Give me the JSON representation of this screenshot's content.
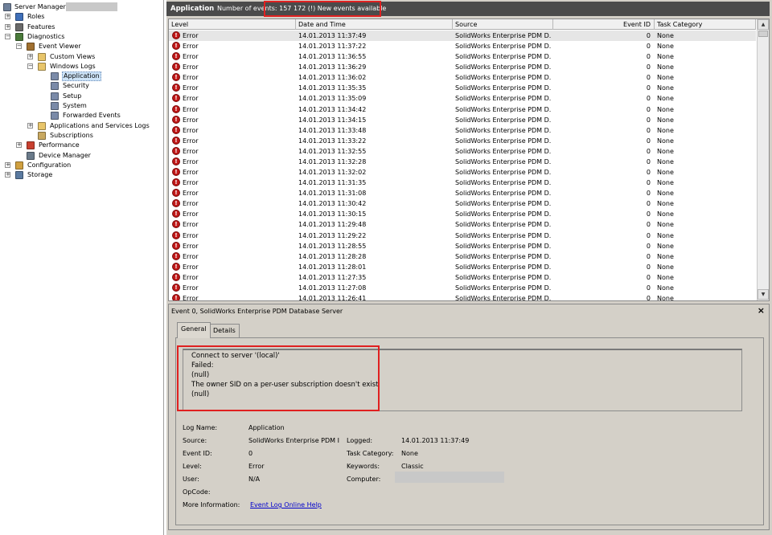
{
  "tree": {
    "items": [
      {
        "label": "Server Manager",
        "expander": "",
        "icon": "server-icon",
        "color": "#6d7f99",
        "level": 0
      },
      {
        "label": "Roles",
        "expander": "+",
        "icon": "roles-icon",
        "color": "#3f6fb8",
        "level": 1
      },
      {
        "label": "Features",
        "expander": "+",
        "icon": "features-icon",
        "color": "#6a6a6a",
        "level": 1
      },
      {
        "label": "Diagnostics",
        "expander": "−",
        "icon": "diagnostics-icon",
        "color": "#4a7a3a",
        "level": 1
      },
      {
        "label": "Event Viewer",
        "expander": "−",
        "icon": "event-viewer-icon",
        "color": "#a07030",
        "level": 2
      },
      {
        "label": "Custom Views",
        "expander": "+",
        "icon": "folder-icon",
        "color": "#e8c56a",
        "level": 3
      },
      {
        "label": "Windows Logs",
        "expander": "−",
        "icon": "folder-icon",
        "color": "#e8c56a",
        "level": 3
      },
      {
        "label": "Application",
        "expander": "",
        "icon": "log-icon",
        "color": "#7a8aa8",
        "level": 4,
        "selected": true
      },
      {
        "label": "Security",
        "expander": "",
        "icon": "log-icon",
        "color": "#7a8aa8",
        "level": 4
      },
      {
        "label": "Setup",
        "expander": "",
        "icon": "log-icon",
        "color": "#7a8aa8",
        "level": 4
      },
      {
        "label": "System",
        "expander": "",
        "icon": "log-icon",
        "color": "#7a8aa8",
        "level": 4
      },
      {
        "label": "Forwarded Events",
        "expander": "",
        "icon": "log-icon",
        "color": "#7a8aa8",
        "level": 4
      },
      {
        "label": "Applications and Services Logs",
        "expander": "+",
        "icon": "folder-icon",
        "color": "#e8c56a",
        "level": 3
      },
      {
        "label": "Subscriptions",
        "expander": "",
        "icon": "subscriptions-icon",
        "color": "#c8a860",
        "level": 3
      },
      {
        "label": "Performance",
        "expander": "+",
        "icon": "performance-icon",
        "color": "#c84030",
        "level": 2
      },
      {
        "label": "Device Manager",
        "expander": "",
        "icon": "device-manager-icon",
        "color": "#6a7a8a",
        "level": 2
      },
      {
        "label": "Configuration",
        "expander": "+",
        "icon": "configuration-icon",
        "color": "#d0a040",
        "level": 1
      },
      {
        "label": "Storage",
        "expander": "+",
        "icon": "storage-icon",
        "color": "#5a7aa0",
        "level": 1
      }
    ]
  },
  "titlebar": {
    "app_name": "Application",
    "event_count": "Number of events: 157 172 (!) New events available"
  },
  "grid": {
    "columns": [
      "Level",
      "Date and Time",
      "Source",
      "Event ID",
      "Task Category"
    ],
    "rows": [
      {
        "level": "Error",
        "time": "14.01.2013 11:37:49",
        "source": "SolidWorks Enterprise PDM D...",
        "id": "0",
        "category": "None"
      },
      {
        "level": "Error",
        "time": "14.01.2013 11:37:22",
        "source": "SolidWorks Enterprise PDM D...",
        "id": "0",
        "category": "None"
      },
      {
        "level": "Error",
        "time": "14.01.2013 11:36:55",
        "source": "SolidWorks Enterprise PDM D...",
        "id": "0",
        "category": "None"
      },
      {
        "level": "Error",
        "time": "14.01.2013 11:36:29",
        "source": "SolidWorks Enterprise PDM D...",
        "id": "0",
        "category": "None"
      },
      {
        "level": "Error",
        "time": "14.01.2013 11:36:02",
        "source": "SolidWorks Enterprise PDM D...",
        "id": "0",
        "category": "None"
      },
      {
        "level": "Error",
        "time": "14.01.2013 11:35:35",
        "source": "SolidWorks Enterprise PDM D...",
        "id": "0",
        "category": "None"
      },
      {
        "level": "Error",
        "time": "14.01.2013 11:35:09",
        "source": "SolidWorks Enterprise PDM D...",
        "id": "0",
        "category": "None"
      },
      {
        "level": "Error",
        "time": "14.01.2013 11:34:42",
        "source": "SolidWorks Enterprise PDM D...",
        "id": "0",
        "category": "None"
      },
      {
        "level": "Error",
        "time": "14.01.2013 11:34:15",
        "source": "SolidWorks Enterprise PDM D...",
        "id": "0",
        "category": "None"
      },
      {
        "level": "Error",
        "time": "14.01.2013 11:33:48",
        "source": "SolidWorks Enterprise PDM D...",
        "id": "0",
        "category": "None"
      },
      {
        "level": "Error",
        "time": "14.01.2013 11:33:22",
        "source": "SolidWorks Enterprise PDM D...",
        "id": "0",
        "category": "None"
      },
      {
        "level": "Error",
        "time": "14.01.2013 11:32:55",
        "source": "SolidWorks Enterprise PDM D...",
        "id": "0",
        "category": "None"
      },
      {
        "level": "Error",
        "time": "14.01.2013 11:32:28",
        "source": "SolidWorks Enterprise PDM D...",
        "id": "0",
        "category": "None"
      },
      {
        "level": "Error",
        "time": "14.01.2013 11:32:02",
        "source": "SolidWorks Enterprise PDM D...",
        "id": "0",
        "category": "None"
      },
      {
        "level": "Error",
        "time": "14.01.2013 11:31:35",
        "source": "SolidWorks Enterprise PDM D...",
        "id": "0",
        "category": "None"
      },
      {
        "level": "Error",
        "time": "14.01.2013 11:31:08",
        "source": "SolidWorks Enterprise PDM D...",
        "id": "0",
        "category": "None"
      },
      {
        "level": "Error",
        "time": "14.01.2013 11:30:42",
        "source": "SolidWorks Enterprise PDM D...",
        "id": "0",
        "category": "None"
      },
      {
        "level": "Error",
        "time": "14.01.2013 11:30:15",
        "source": "SolidWorks Enterprise PDM D...",
        "id": "0",
        "category": "None"
      },
      {
        "level": "Error",
        "time": "14.01.2013 11:29:48",
        "source": "SolidWorks Enterprise PDM D...",
        "id": "0",
        "category": "None"
      },
      {
        "level": "Error",
        "time": "14.01.2013 11:29:22",
        "source": "SolidWorks Enterprise PDM D...",
        "id": "0",
        "category": "None"
      },
      {
        "level": "Error",
        "time": "14.01.2013 11:28:55",
        "source": "SolidWorks Enterprise PDM D...",
        "id": "0",
        "category": "None"
      },
      {
        "level": "Error",
        "time": "14.01.2013 11:28:28",
        "source": "SolidWorks Enterprise PDM D...",
        "id": "0",
        "category": "None"
      },
      {
        "level": "Error",
        "time": "14.01.2013 11:28:01",
        "source": "SolidWorks Enterprise PDM D...",
        "id": "0",
        "category": "None"
      },
      {
        "level": "Error",
        "time": "14.01.2013 11:27:35",
        "source": "SolidWorks Enterprise PDM D...",
        "id": "0",
        "category": "None"
      },
      {
        "level": "Error",
        "time": "14.01.2013 11:27:08",
        "source": "SolidWorks Enterprise PDM D...",
        "id": "0",
        "category": "None"
      },
      {
        "level": "Error",
        "time": "14.01.2013 11:26:41",
        "source": "SolidWorks Enterprise PDM D...",
        "id": "0",
        "category": "None"
      }
    ]
  },
  "details": {
    "title": "Event 0, SolidWorks Enterprise PDM Database Server",
    "close_glyph": "×",
    "tabs": [
      "General",
      "Details"
    ],
    "message_lines": [
      "Connect to server '(local)'",
      "Failed:",
      "(null)",
      "The owner SID on a per-user subscription doesn't exist",
      "(null)"
    ],
    "props": {
      "log_name_label": "Log Name:",
      "log_name": "Application",
      "source_label": "Source:",
      "source": "SolidWorks Enterprise PDM I",
      "logged_label": "Logged:",
      "logged": "14.01.2013 11:37:49",
      "event_id_label": "Event ID:",
      "event_id": "0",
      "task_category_label": "Task Category:",
      "task_category": "None",
      "level_label": "Level:",
      "level": "Error",
      "keywords_label": "Keywords:",
      "keywords": "Classic",
      "user_label": "User:",
      "user": "N/A",
      "computer_label": "Computer:",
      "opcode_label": "OpCode:",
      "more_info_label": "More Information:",
      "more_info_link": "Event Log Online Help"
    }
  },
  "colors": {
    "titlebar_bg": "#4b4b4b",
    "highlight_red": "#e02020",
    "error_red": "#c01818",
    "link_blue": "#0000cc"
  }
}
